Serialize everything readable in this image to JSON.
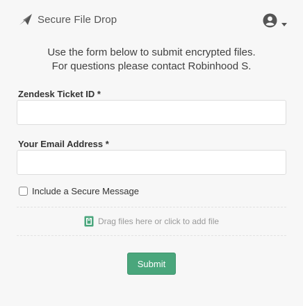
{
  "app": {
    "title": "Secure File Drop",
    "icon": "paper-plane-icon",
    "user_menu": {
      "icon": "user-circle-icon",
      "caret_icon": "caret-down-icon"
    }
  },
  "intro": {
    "line1": "Use the form below to submit encrypted files.",
    "line2": "For questions please contact Robinhood S."
  },
  "form": {
    "ticket_id": {
      "label": "Zendesk Ticket ID *",
      "value": "",
      "placeholder": ""
    },
    "email": {
      "label": "Your Email Address *",
      "value": "",
      "placeholder": ""
    },
    "secure_message": {
      "label": "Include a Secure Message",
      "checked": false
    },
    "dropzone": {
      "icon": "file-lock-icon",
      "text": "Drag files here or click to add file"
    },
    "submit_label": "Submit"
  },
  "colors": {
    "background": "#f7f7f7",
    "accent_green": "#4aa67c",
    "icon_dark": "#555555",
    "dropzone_icon": "#4aa67c"
  }
}
